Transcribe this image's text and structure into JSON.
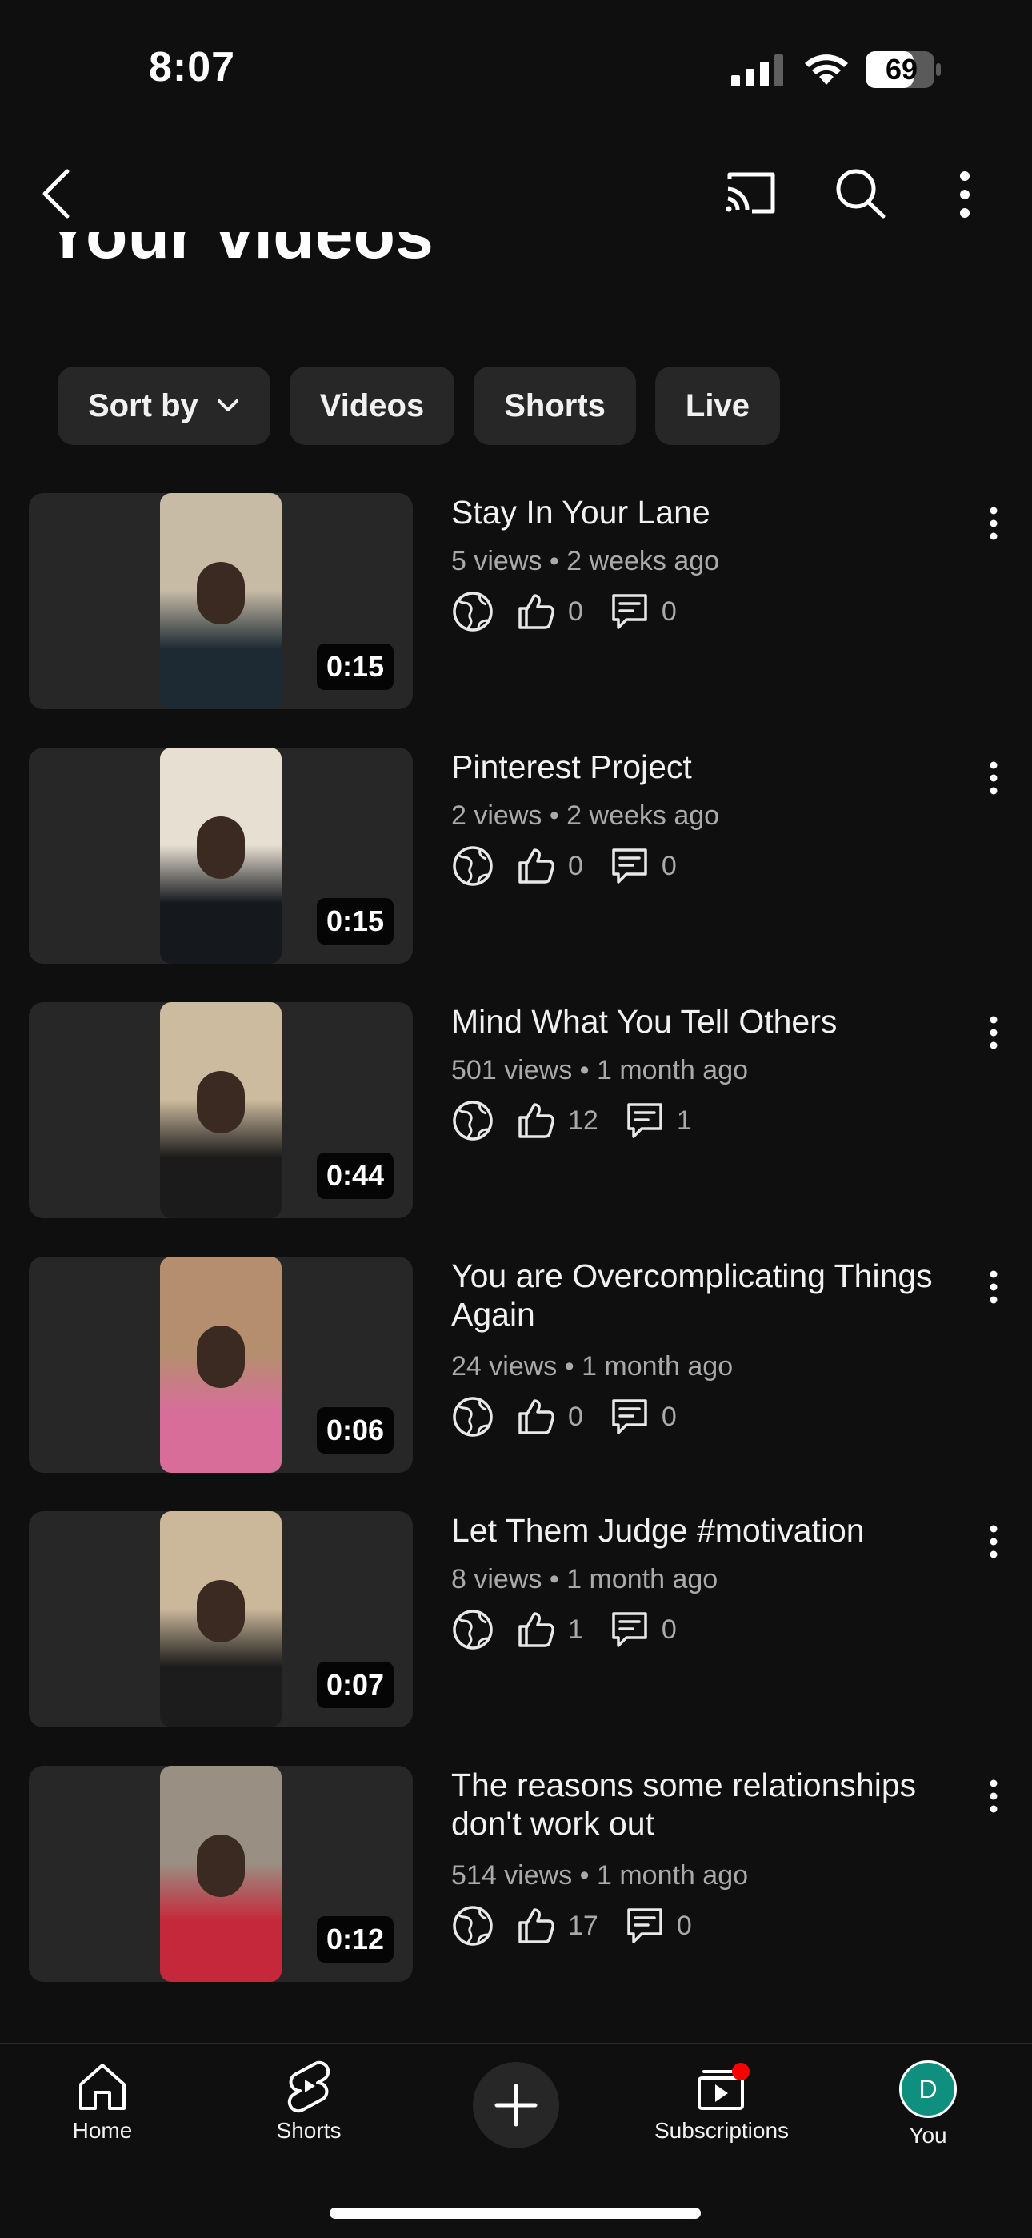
{
  "status_bar": {
    "time": "8:07",
    "battery": "69"
  },
  "header": {
    "title": "Your videos",
    "icons": [
      "back-arrow-icon",
      "cast-icon",
      "search-icon",
      "more-vertical-icon"
    ]
  },
  "chips": [
    {
      "label": "Sort by",
      "dropdown": true
    },
    {
      "label": "Videos"
    },
    {
      "label": "Shorts"
    },
    {
      "label": "Live"
    }
  ],
  "videos": [
    {
      "title": "Stay In Your Lane",
      "meta": "5 views • 2 weeks ago",
      "likes": "0",
      "comments": "0",
      "duration": "0:15",
      "thumb_colors": [
        "#c7bba6",
        "#1d2a33"
      ]
    },
    {
      "title": "Pinterest Project",
      "meta": "2 views • 2 weeks ago",
      "likes": "0",
      "comments": "0",
      "duration": "0:15",
      "thumb_colors": [
        "#e7dfd2",
        "#15191e"
      ]
    },
    {
      "title": "Mind What You Tell Others",
      "meta": "501 views • 1 month ago",
      "likes": "12",
      "comments": "1",
      "duration": "0:44",
      "thumb_colors": [
        "#cdbb9f",
        "#1b1b1b"
      ]
    },
    {
      "title": "You are Overcomplicating Things Again",
      "meta": "24 views • 1 month ago",
      "likes": "0",
      "comments": "0",
      "duration": "0:06",
      "thumb_colors": [
        "#b58e6f",
        "#d86d9a"
      ]
    },
    {
      "title": "Let Them Judge #motivation",
      "meta": "8 views • 1 month ago",
      "likes": "1",
      "comments": "0",
      "duration": "0:07",
      "thumb_colors": [
        "#cbb89b",
        "#1c1c1c"
      ]
    },
    {
      "title": "The reasons some relationships don't work out",
      "meta": "514 views • 1 month ago",
      "likes": "17",
      "comments": "0",
      "duration": "0:12",
      "thumb_colors": [
        "#9a8f83",
        "#c5283a"
      ]
    }
  ],
  "bottom_nav": {
    "home": "Home",
    "shorts": "Shorts",
    "subscriptions": "Subscriptions",
    "you": "You",
    "avatar_letter": "D",
    "accent": "#ff0000"
  }
}
